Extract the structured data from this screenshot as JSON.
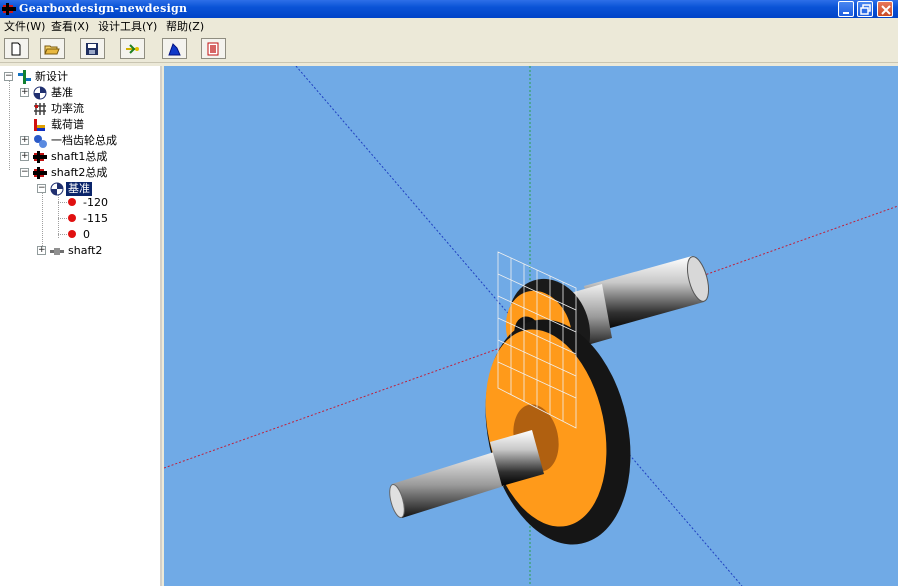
{
  "window": {
    "title": "Gearboxdesign-newdesign",
    "controls": [
      "minimize",
      "maximize",
      "close"
    ]
  },
  "menu": [
    {
      "label": "文件(W)"
    },
    {
      "label": "查看(X)"
    },
    {
      "label": "设计工具(Y)"
    },
    {
      "label": "帮助(Z)"
    }
  ],
  "toolbar": {
    "buttons": [
      "new-file-icon",
      "open-folder-icon",
      "save-icon",
      "power-flow-icon",
      "shape-icon",
      "stop-icon"
    ]
  },
  "tree": {
    "root": {
      "label": "新设计",
      "icon": "design-icon",
      "expanded": true
    },
    "items": [
      {
        "label": "基准",
        "icon": "datum-icon",
        "expanded": false
      },
      {
        "label": "功率流",
        "icon": "power-flow-icon"
      },
      {
        "label": "载荷谱",
        "icon": "load-spectrum-icon"
      },
      {
        "label": "一档齿轮总成",
        "icon": "gear-pair-icon",
        "expanded": false
      },
      {
        "label": "shaft1总成",
        "icon": "shaft-assembly-icon",
        "expanded": false
      },
      {
        "label": "shaft2总成",
        "icon": "shaft-assembly-icon",
        "expanded": true
      }
    ],
    "shaft2_children": {
      "datum": {
        "label": "基准",
        "icon": "datum-icon",
        "selected": true,
        "expanded": true
      },
      "datum_points": [
        {
          "label": "-120"
        },
        {
          "label": "-115"
        },
        {
          "label": "0"
        }
      ],
      "shaft": {
        "label": "shaft2",
        "icon": "shaft-icon",
        "expanded": false
      }
    }
  },
  "view": {
    "background": "#70aae6",
    "gear_face_color": "#ff9a1a",
    "teeth_color": "#1a1a1a",
    "axis_colors": {
      "x": "#c0203a",
      "y": "#2a9e4a",
      "z": "#2040c0"
    }
  }
}
